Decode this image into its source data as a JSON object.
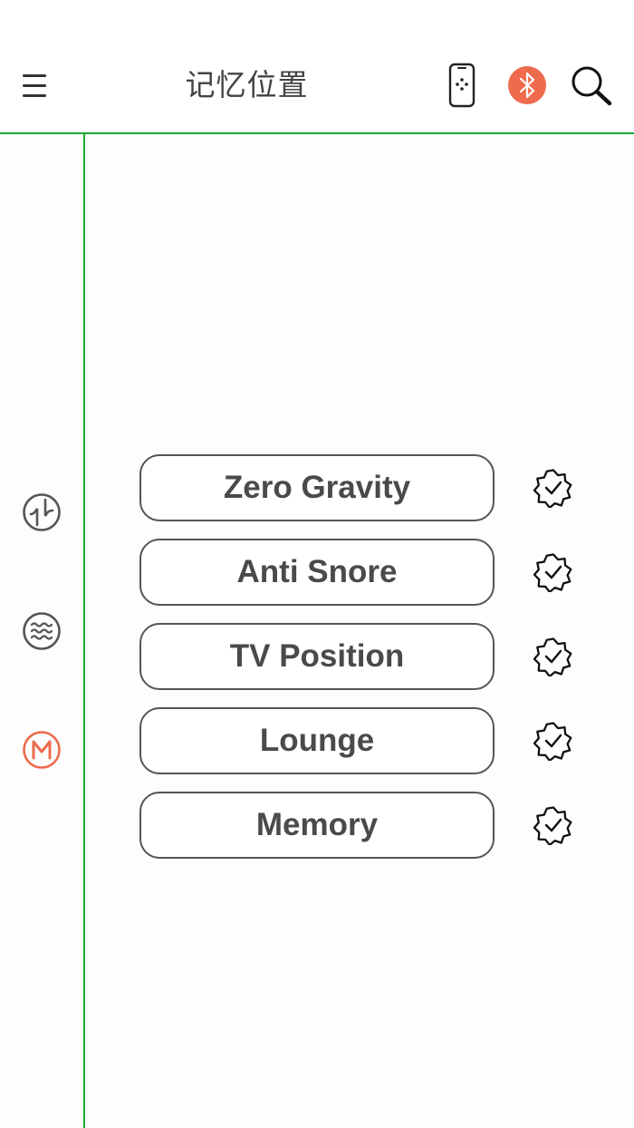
{
  "header": {
    "title": "记忆位置",
    "icons": {
      "menu": "menu-icon",
      "remote": "remote-phone-icon",
      "bluetooth": "bluetooth-icon",
      "search": "search-icon"
    }
  },
  "sidebar": {
    "items": [
      {
        "icon": "massage-wave-icon",
        "active": false
      },
      {
        "icon": "vibration-icon",
        "active": false
      },
      {
        "icon": "memory-m-icon",
        "active": true
      }
    ]
  },
  "memory_positions": [
    {
      "label": "Zero Gravity"
    },
    {
      "label": "Anti Snore"
    },
    {
      "label": "TV Position"
    },
    {
      "label": "Lounge"
    },
    {
      "label": "Memory"
    }
  ],
  "colors": {
    "accent": "#1aa832",
    "active": "#ee6b4d",
    "text": "#4a4a4a"
  }
}
